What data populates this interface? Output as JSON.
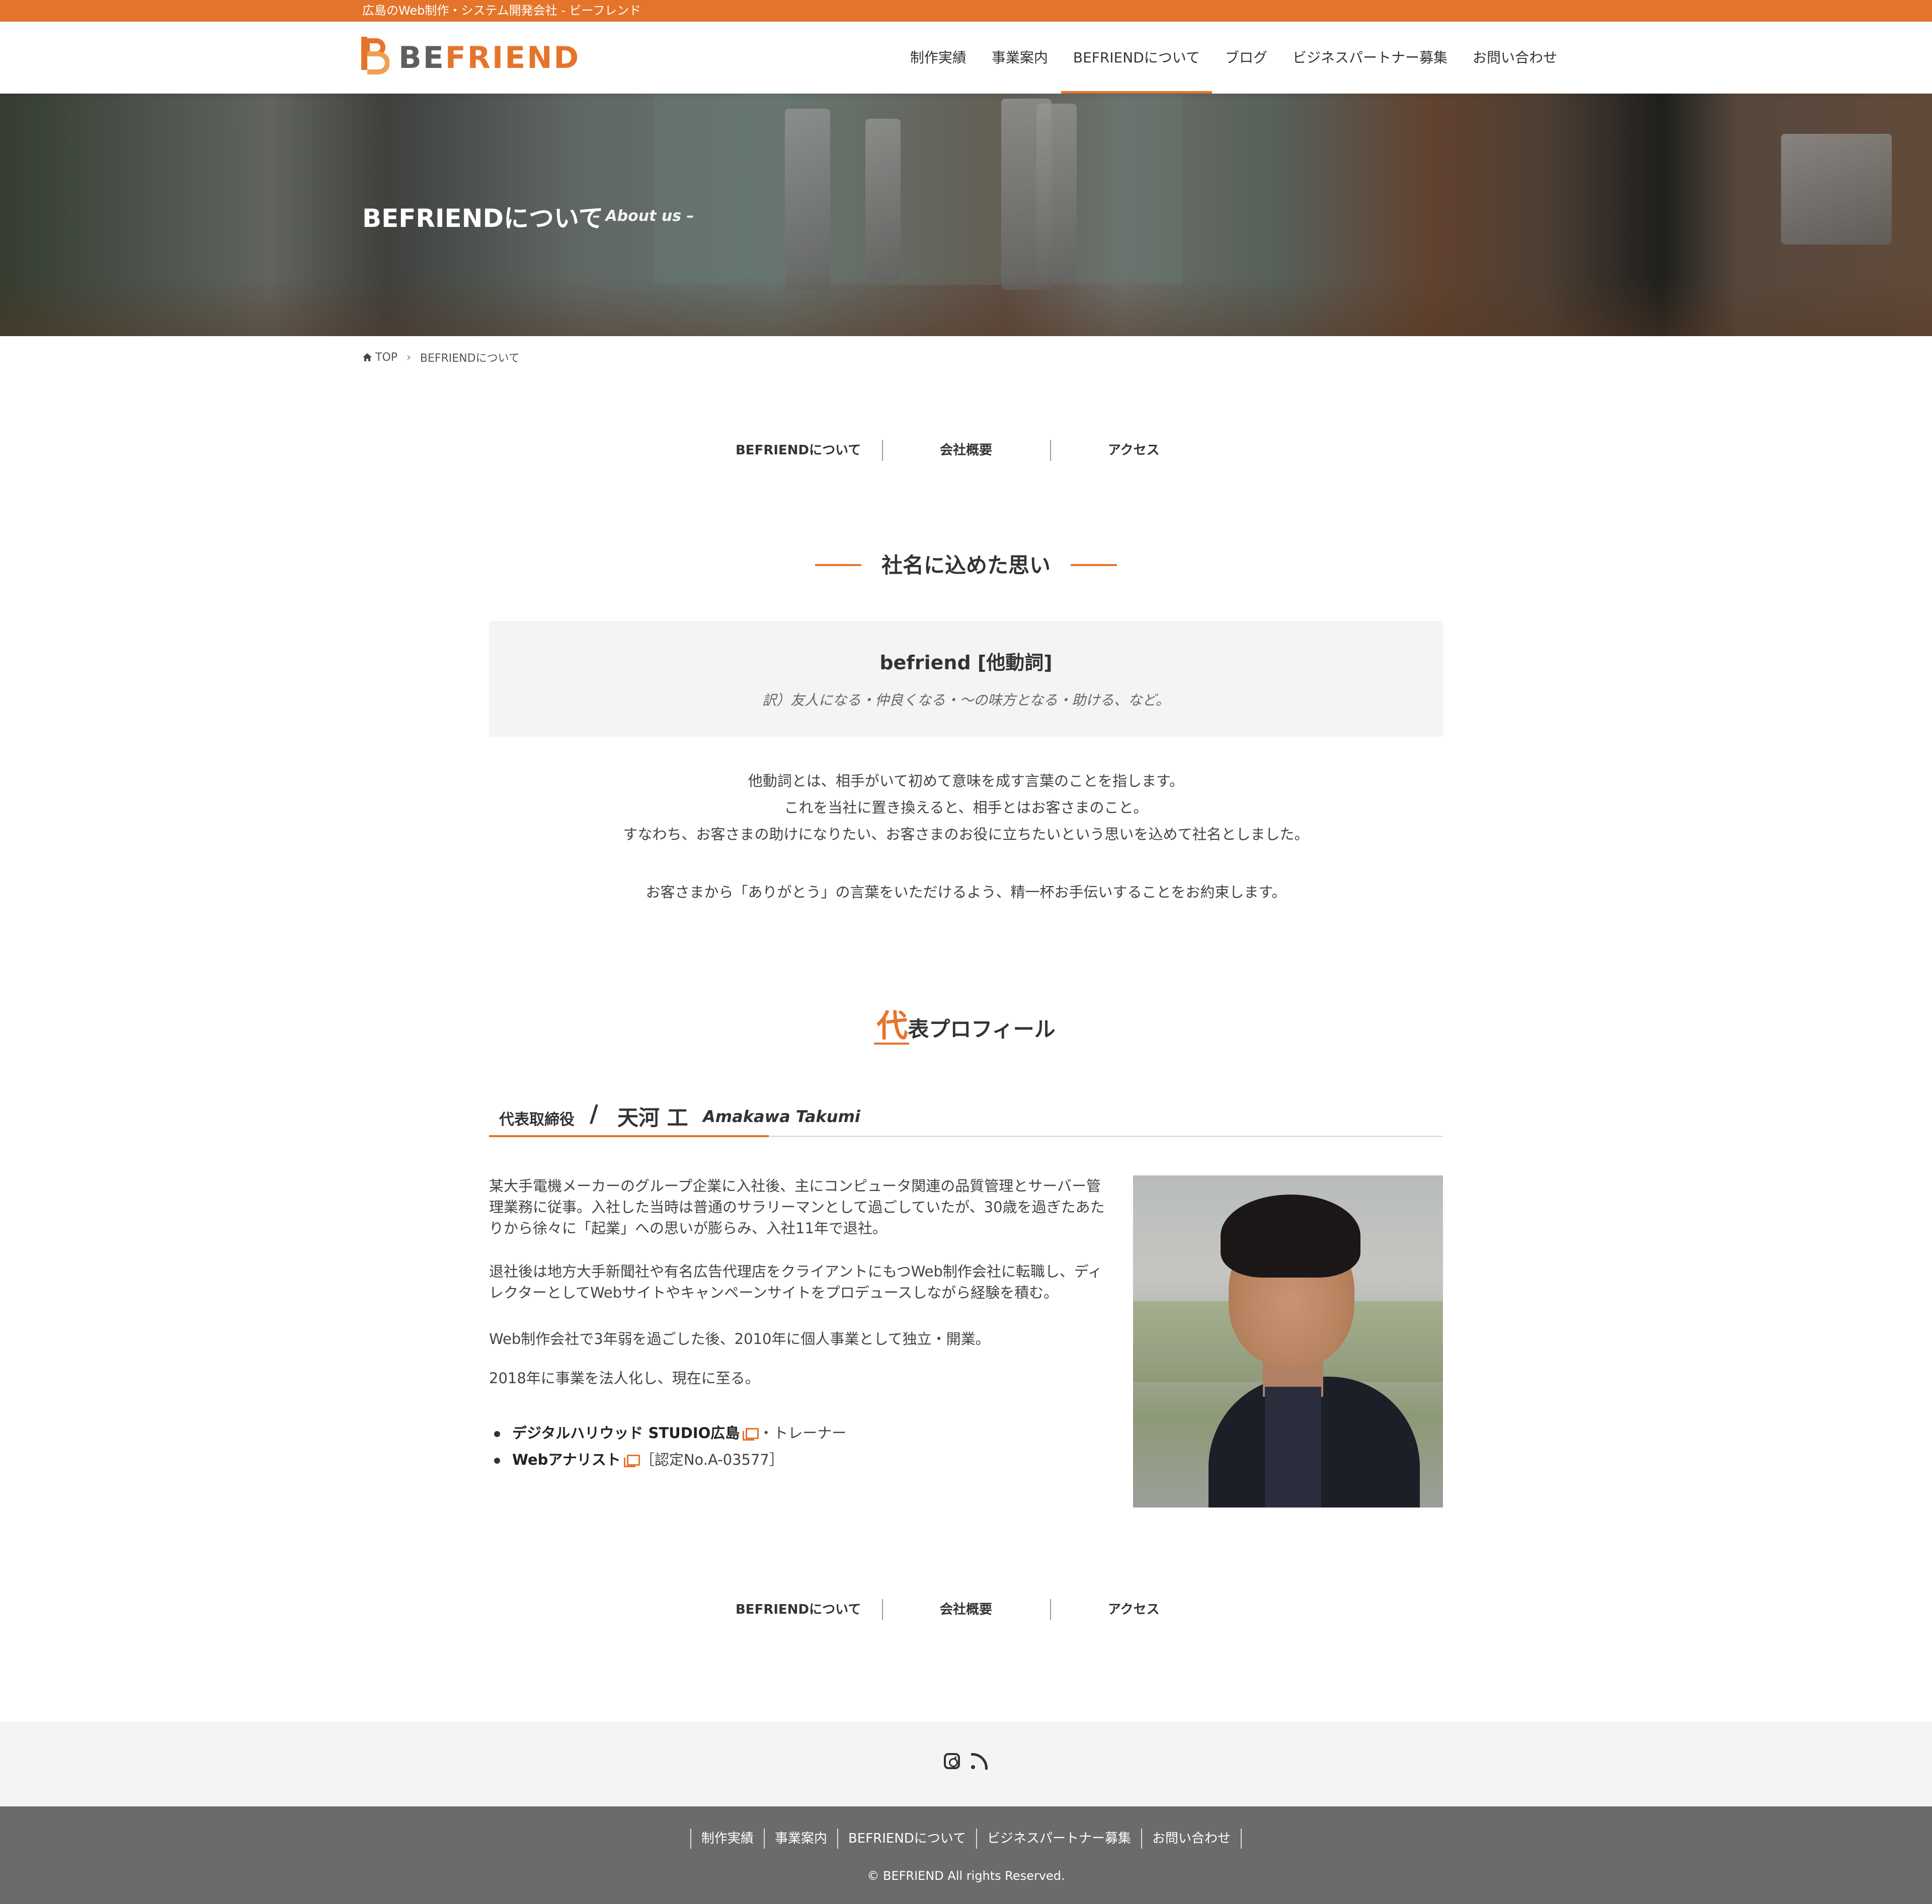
{
  "topbar": {
    "tagline": "広島のWeb制作・システム開発会社 - ビーフレンド"
  },
  "header": {
    "logo": {
      "be": "BE",
      "friend": "FRIEND"
    },
    "nav": [
      {
        "label": "制作実績"
      },
      {
        "label": "事業案内"
      },
      {
        "label": "BEFRIENDについて",
        "active": true
      },
      {
        "label": "ブログ"
      },
      {
        "label": "ビジネスパートナー募集"
      },
      {
        "label": "お問い合わせ"
      }
    ]
  },
  "hero": {
    "title": "BEFRIENDについて",
    "subtitle": "– About us –"
  },
  "breadcrumb": {
    "home": "TOP",
    "current": "BEFRIENDについて"
  },
  "subnav": [
    "BEFRIENDについて",
    "会社概要",
    "アクセス"
  ],
  "section_name": {
    "heading": "社名に込めた思い",
    "word": "befriend [他動詞]",
    "translation": "訳）友人になる・仲良くなる・〜の味方となる・助ける、など。",
    "lines": [
      "他動詞とは、相手がいて初めて意味を成す言葉のことを指します。",
      "これを当社に置き換えると、相手とはお客さまのこと。",
      "すなわち、お客さまの助けになりたい、お客さまのお役に立ちたいという思いを込めて社名としました。",
      "お客さまから「ありがとう」の言葉をいただけるよう、精一杯お手伝いすることをお約束します。"
    ]
  },
  "profile": {
    "heading_first": "代",
    "heading_rest": "表プロフィール",
    "title": "代表取締役",
    "slash": "/",
    "name_jp": "天河 工",
    "name_en": "Amakawa Takumi",
    "paragraphs": [
      "某大手電機メーカーのグループ企業に入社後、主にコンピュータ関連の品質管理とサーバー管理業務に従事。入社した当時は普通のサラリーマンとして過ごしていたが、30歳を過ぎたあたりから徐々に「起業」への思いが膨らみ、入社11年で退社。",
      "退社後は地方大手新聞社や有名広告代理店をクライアントにもつWeb制作会社に転職し、ディレクターとしてWebサイトやキャンペーンサイトをプロデュースしながら経験を積む。",
      "Web制作会社で3年弱を過ごした後、2010年に個人事業として独立・開業。",
      "2018年に事業を法人化し、現在に至る。"
    ],
    "creds": [
      {
        "name": "デジタルハリウッド STUDIO広島",
        "suffix": "・トレーナー"
      },
      {
        "name": "Webアナリスト",
        "suffix": "［認定No.A-03577］"
      }
    ]
  },
  "footer": {
    "social": [
      "instagram-icon",
      "rss-icon"
    ],
    "nav": [
      "制作実績",
      "事業案内",
      "BEFRIENDについて",
      "ビジネスパートナー募集",
      "お問い合わせ"
    ],
    "copyright": "© BEFRIEND All rights Reserved."
  },
  "colors": {
    "accent": "#e5742b",
    "footer_bg": "#6b6b6b",
    "box_bg": "#f4f4f4"
  }
}
